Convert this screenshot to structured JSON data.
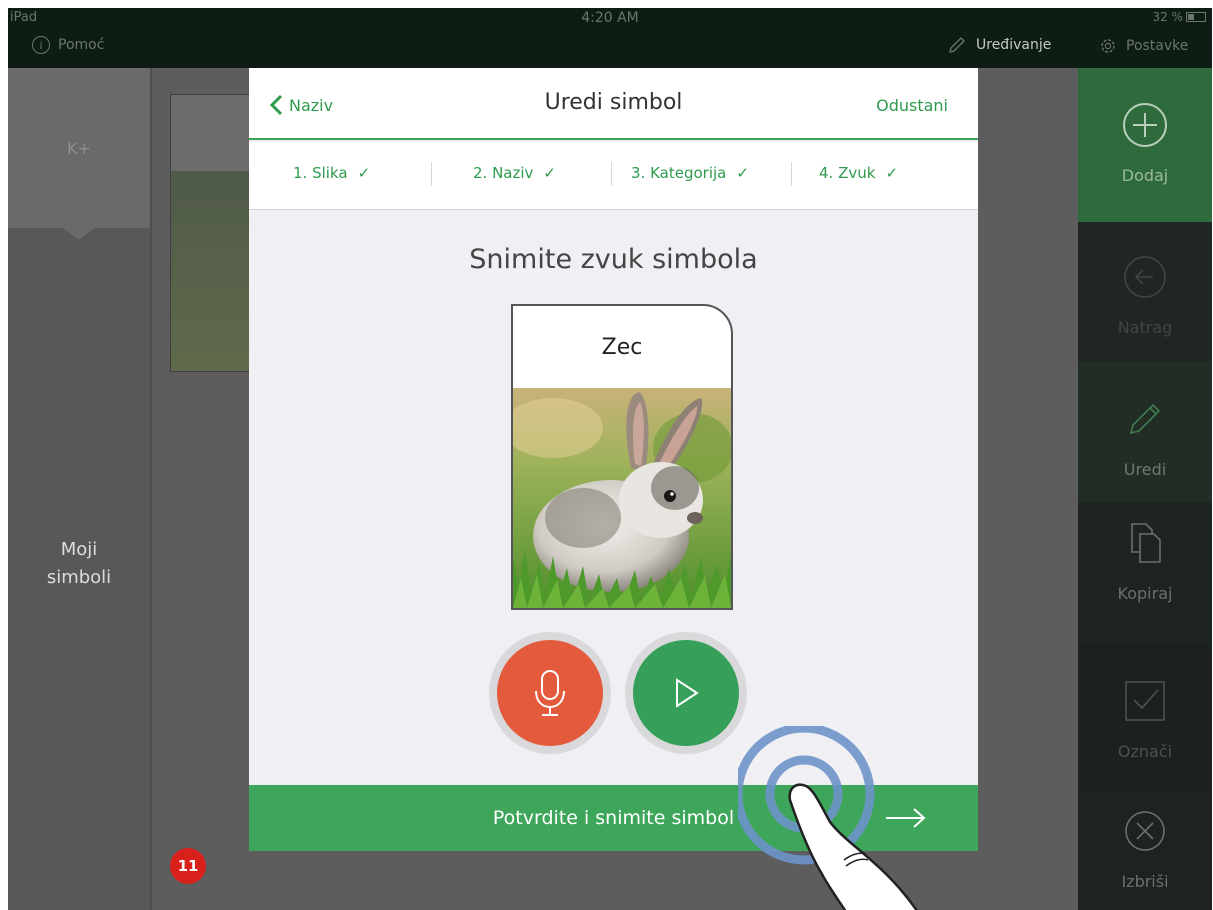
{
  "status_bar": {
    "carrier": "iPad",
    "time": "4:20 AM",
    "battery": "32 %",
    "help_label": "Pomoć",
    "edit_mode_label": "Uređivanje",
    "settings_label": "Postavke"
  },
  "categories": {
    "top": "K+",
    "my_symbols": "Moji\nsimboli"
  },
  "badge_count": "11",
  "toolbar": {
    "add": "Dodaj",
    "back": "Natrag",
    "edit": "Uredi",
    "copy": "Kopiraj",
    "mark": "Označi",
    "delete": "Izbriši"
  },
  "modal": {
    "back_label": "Naziv",
    "title": "Uredi simbol",
    "cancel_label": "Odustani",
    "steps": [
      {
        "label": "1. Slika",
        "check": "✓"
      },
      {
        "label": "2. Naziv",
        "check": "✓"
      },
      {
        "label": "3. Kategorija",
        "check": "✓"
      },
      {
        "label": "4. Zvuk",
        "check": "✓"
      }
    ],
    "heading": "Snimite zvuk simbola",
    "symbol_name": "Zec",
    "confirm_label": "Potvrdite i snimite simbol"
  },
  "colors": {
    "accent_green": "#3da65a",
    "record_red": "#e35b3c",
    "badge_red": "#d8211b"
  }
}
